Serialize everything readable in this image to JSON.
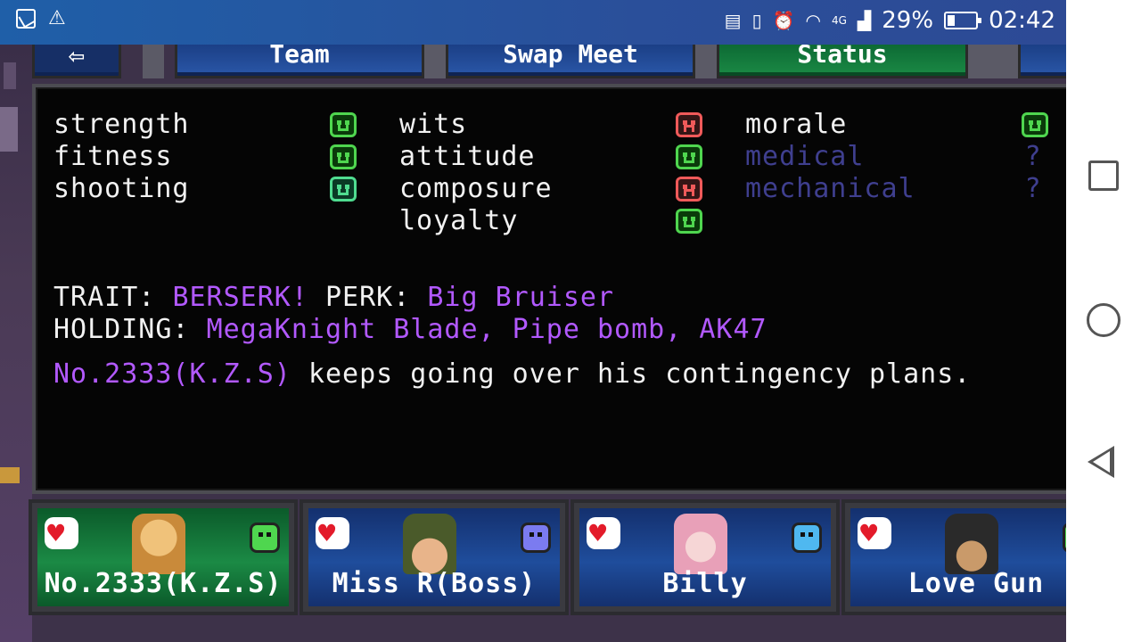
{
  "status_bar": {
    "signal_label": "4G",
    "battery_percent": "29%",
    "time": "02:42",
    "icons": [
      "image-icon",
      "warning-icon",
      "nfc-icon",
      "vibrate-icon",
      "alarm-icon",
      "wifi-icon",
      "signal-icon",
      "battery-icon"
    ]
  },
  "tabs": {
    "back_icon": "⇦",
    "team": "Team",
    "swap_meet": "Swap Meet",
    "status": "Status",
    "active": "status"
  },
  "stats": {
    "col1": [
      {
        "label": "strength",
        "mood": "good"
      },
      {
        "label": "fitness",
        "mood": "good"
      },
      {
        "label": "shooting",
        "mood": "great"
      }
    ],
    "col2": [
      {
        "label": "wits",
        "mood": "bad"
      },
      {
        "label": "attitude",
        "mood": "good"
      },
      {
        "label": "composure",
        "mood": "bad"
      },
      {
        "label": "loyalty",
        "mood": "good"
      }
    ],
    "col3": [
      {
        "label": "morale",
        "mood": "good"
      },
      {
        "label": "medical",
        "mood": "unknown",
        "value": "?"
      },
      {
        "label": "mechanical",
        "mood": "unknown",
        "value": "?"
      }
    ]
  },
  "info": {
    "trait_label": "TRAIT:",
    "trait_value": "BERSERK!",
    "perk_label": "PERK:",
    "perk_value": "Big Bruiser",
    "holding_label": "HOLDING:",
    "holding_value": "MegaKnight Blade, Pipe bomb, AK47"
  },
  "narration": {
    "subject": "No.2333(K.Z.S)",
    "text": "keeps going over his contingency plans."
  },
  "team": [
    {
      "name": "No.2333(K.Z.S)",
      "active": true,
      "mood_color": "#4fd64f"
    },
    {
      "name": "Miss R(Boss)",
      "active": false,
      "mood_color": "#7b7bf0"
    },
    {
      "name": "Billy",
      "active": false,
      "mood_color": "#4fb8f0"
    },
    {
      "name": "Love Gun",
      "active": false,
      "mood_color": "#4fd64f"
    }
  ],
  "colors": {
    "accent_purple": "#b259ff",
    "good_green": "#4fd64f",
    "bad_red": "#f05a5a",
    "unknown_blue": "#3f3f8f"
  }
}
